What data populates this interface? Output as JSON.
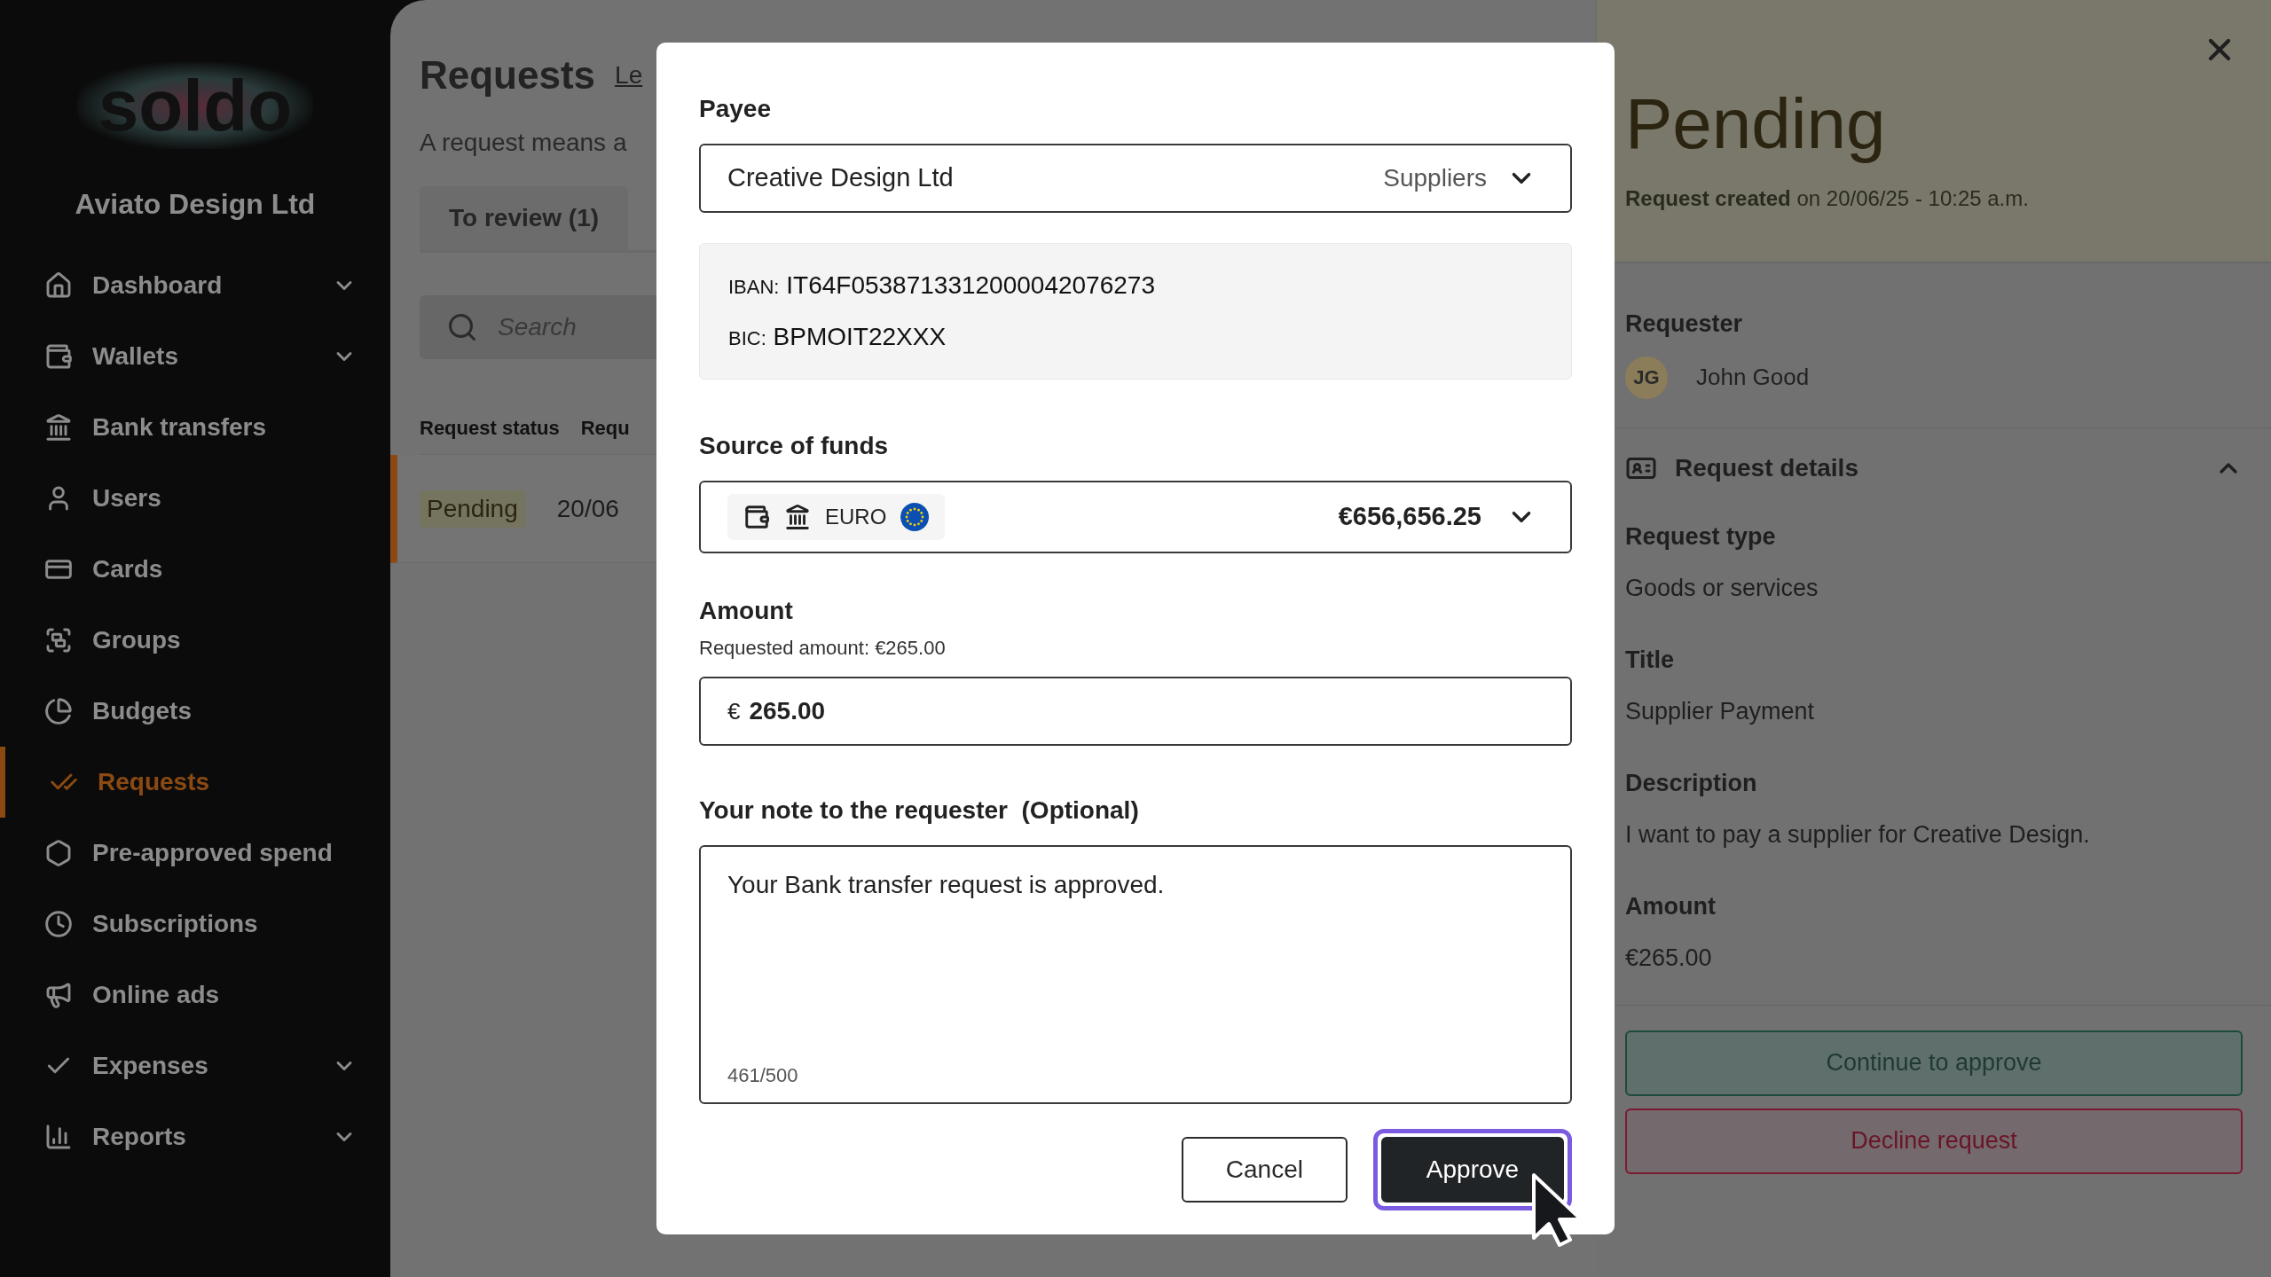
{
  "sidebar": {
    "logo": "soldo",
    "company": "Aviato Design Ltd",
    "items": [
      {
        "label": "Dashboard",
        "has_submenu": true,
        "selected": false
      },
      {
        "label": "Wallets",
        "has_submenu": true,
        "selected": false
      },
      {
        "label": "Bank transfers",
        "has_submenu": false,
        "selected": false
      },
      {
        "label": "Users",
        "has_submenu": false,
        "selected": false
      },
      {
        "label": "Cards",
        "has_submenu": false,
        "selected": false
      },
      {
        "label": "Groups",
        "has_submenu": false,
        "selected": false
      },
      {
        "label": "Budgets",
        "has_submenu": false,
        "selected": false
      },
      {
        "label": "Requests",
        "has_submenu": false,
        "selected": true
      },
      {
        "label": "Pre-approved spend",
        "has_submenu": false,
        "selected": false
      },
      {
        "label": "Subscriptions",
        "has_submenu": false,
        "selected": false
      },
      {
        "label": "Online ads",
        "has_submenu": false,
        "selected": false
      },
      {
        "label": "Expenses",
        "has_submenu": true,
        "selected": false
      },
      {
        "label": "Reports",
        "has_submenu": true,
        "selected": false
      }
    ]
  },
  "main": {
    "title": "Requests",
    "link": "Le",
    "subtitle": "A request means a",
    "tabs": [
      {
        "label": "To review (1)",
        "selected": true
      }
    ],
    "search": {
      "placeholder": "Search"
    },
    "table": {
      "columns": [
        "Request status",
        "Requ"
      ],
      "rows": [
        {
          "cells": [
            "Pending",
            "20/06"
          ],
          "selected": true
        }
      ]
    }
  },
  "modal": {
    "payee": {
      "label": "Payee",
      "value": "Creative Design Ltd",
      "category": "Suppliers"
    },
    "bank_details": [
      {
        "label": "IBAN:",
        "value": "IT64F0538713312000042076273"
      },
      {
        "label": "BIC:",
        "value": "BPMOIT22XXX"
      }
    ],
    "source": {
      "label": "Source of funds",
      "currency": "EURO",
      "balance": "€656,656.25"
    },
    "amount": {
      "label": "Amount",
      "hint": "Requested amount: €265.00",
      "prefix": "€",
      "value": "265.00"
    },
    "note": {
      "label": "Your note to the requester",
      "optional": "(Optional)",
      "value": "Your Bank transfer request is approved.",
      "counter": "461/500"
    },
    "buttons": [
      {
        "label": "Cancel",
        "kind": "secondary",
        "focused": false
      },
      {
        "label": "Approve",
        "kind": "primary",
        "focused": true
      }
    ]
  },
  "details": {
    "status": "Pending",
    "created_label": "Request created",
    "created_on": "on 20/06/25 - 10:25 a.m.",
    "requester": {
      "label": "Requester",
      "initials": "JG",
      "name": "John Good"
    },
    "section": {
      "title": "Request details",
      "expanded": true
    },
    "fields": [
      {
        "label": "Request type",
        "value": "Goods or services"
      },
      {
        "label": "Title",
        "value": "Supplier Payment"
      },
      {
        "label": "Description",
        "value": "I want to pay a supplier for Creative Design."
      },
      {
        "label": "Amount",
        "value": "€265.00"
      }
    ],
    "actions": [
      {
        "label": "Continue to approve",
        "kind": "approve"
      },
      {
        "label": "Decline request",
        "kind": "decline"
      }
    ]
  }
}
